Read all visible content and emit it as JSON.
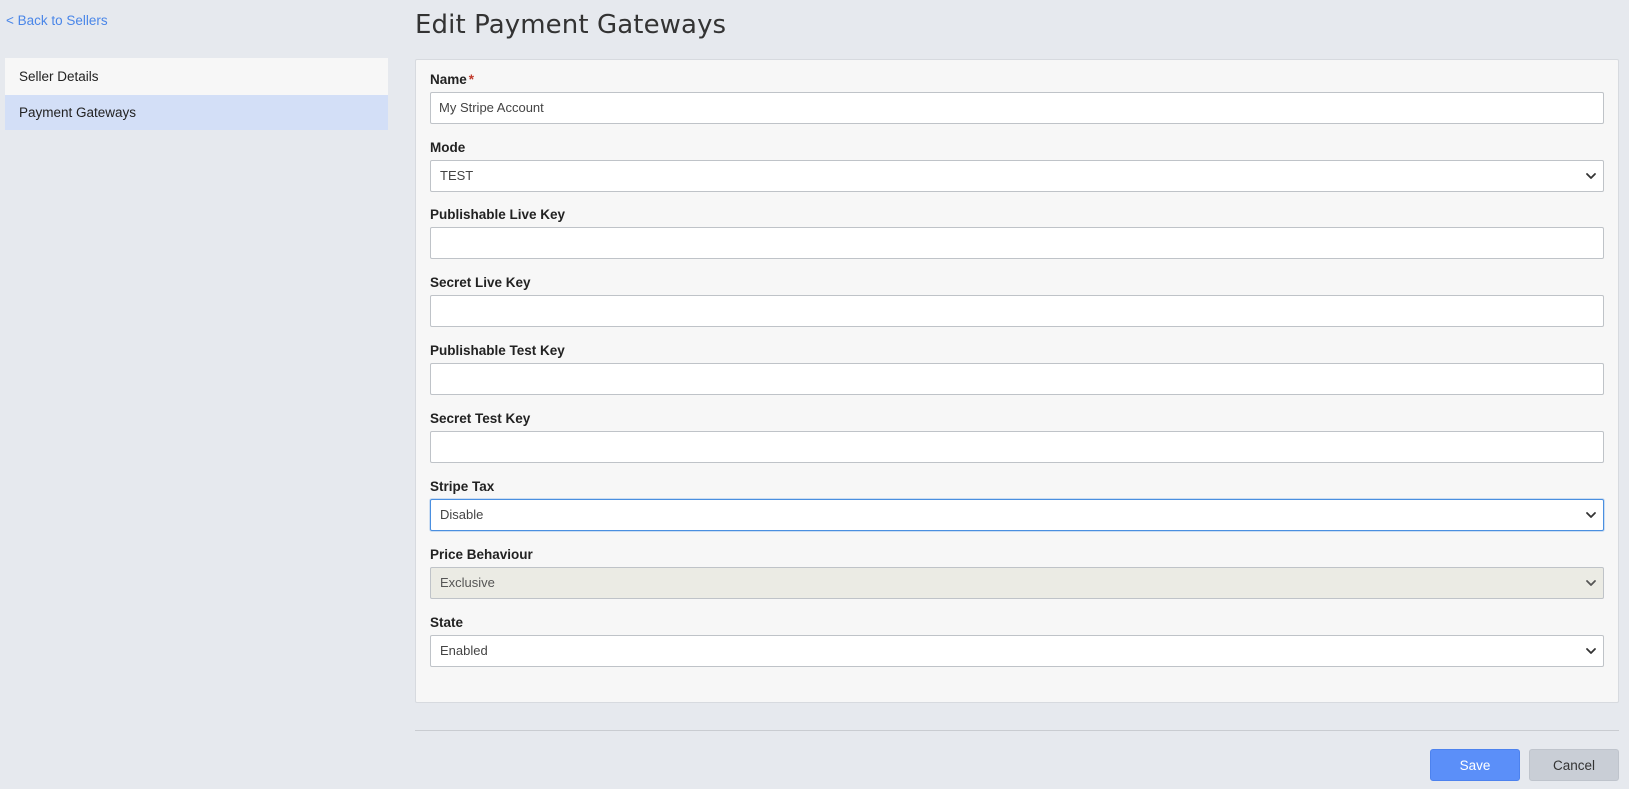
{
  "nav": {
    "back_link": "< Back to Sellers",
    "items": [
      {
        "label": "Seller Details"
      },
      {
        "label": "Payment Gateways"
      }
    ]
  },
  "page": {
    "title": "Edit Payment Gateways"
  },
  "form": {
    "name": {
      "label": "Name",
      "required_mark": "*",
      "value": "My Stripe Account"
    },
    "mode": {
      "label": "Mode",
      "value": "TEST"
    },
    "publishable_live_key": {
      "label": "Publishable Live Key",
      "value": ""
    },
    "secret_live_key": {
      "label": "Secret Live Key",
      "value": ""
    },
    "publishable_test_key": {
      "label": "Publishable Test Key",
      "value": ""
    },
    "secret_test_key": {
      "label": "Secret Test Key",
      "value": ""
    },
    "stripe_tax": {
      "label": "Stripe Tax",
      "value": "Disable"
    },
    "price_behaviour": {
      "label": "Price Behaviour",
      "value": "Exclusive"
    },
    "state": {
      "label": "State",
      "value": "Enabled"
    }
  },
  "actions": {
    "save_label": "Save",
    "cancel_label": "Cancel"
  },
  "icons": {
    "select_arrow": "chevron-down-icon"
  },
  "colors": {
    "accent": "#5b8ff9",
    "link": "#4a86e8",
    "active_nav": "#d3dff7",
    "required": "#c0392b"
  }
}
